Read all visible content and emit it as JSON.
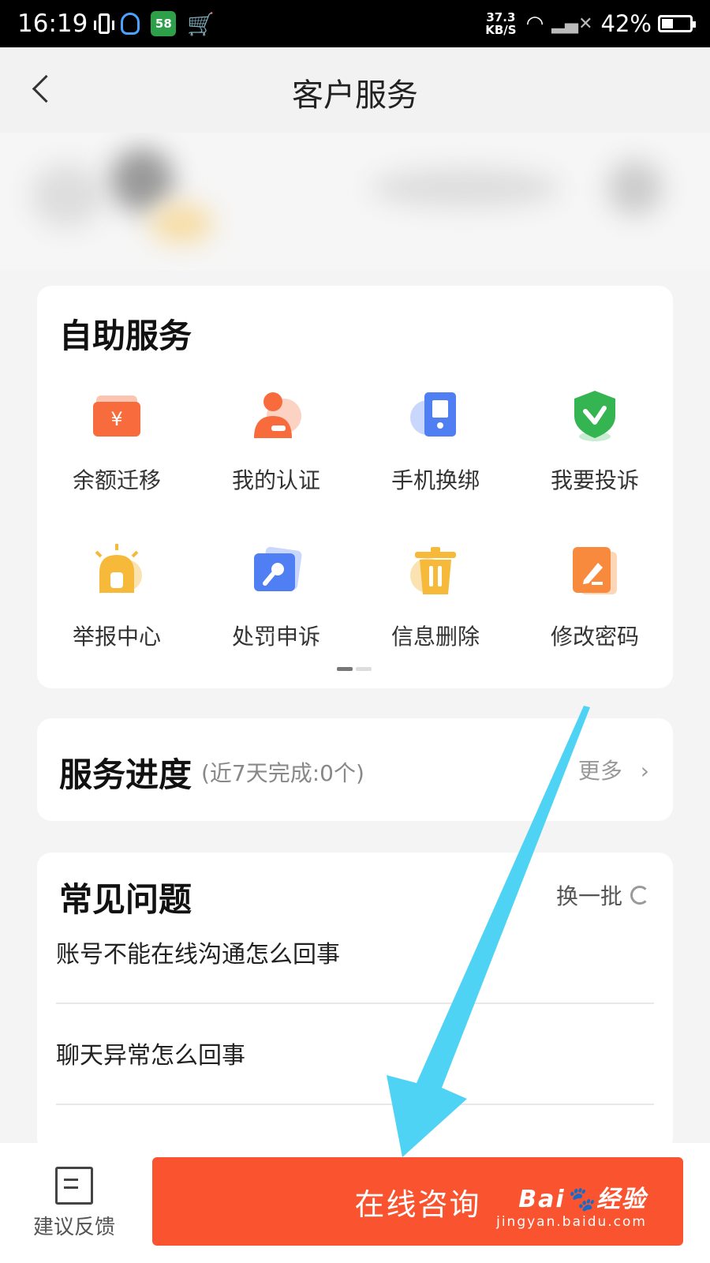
{
  "status_bar": {
    "time": "16:19",
    "app58": "58",
    "net_speed_value": "37.3",
    "net_speed_unit": "KB/S",
    "battery_pct": "42%",
    "battery_level": 0.42
  },
  "navbar": {
    "title": "客户服务"
  },
  "self_service": {
    "title": "自助服务",
    "items": [
      {
        "label": "余额迁移",
        "icon": "wallet-icon",
        "glyph": "¥",
        "color": "#f86b3d"
      },
      {
        "label": "我的认证",
        "icon": "user-verify-icon",
        "color": "#f86b3d"
      },
      {
        "label": "手机换绑",
        "icon": "phone-icon",
        "color": "#4f7ff2"
      },
      {
        "label": "我要投诉",
        "icon": "shield-check-icon",
        "color": "#34b552"
      },
      {
        "label": "举报中心",
        "icon": "alarm-icon",
        "color": "#f6b93a"
      },
      {
        "label": "处罚申诉",
        "icon": "appeal-icon",
        "color": "#4f7ff2"
      },
      {
        "label": "信息删除",
        "icon": "trash-icon",
        "color": "#f6b93a"
      },
      {
        "label": "修改密码",
        "icon": "edit-icon",
        "color": "#f88a3d"
      }
    ],
    "page_indicator": {
      "pages": 2,
      "active": 0
    }
  },
  "service_progress": {
    "title": "服务进度",
    "subtitle": "(近7天完成:0个)",
    "more": "更多"
  },
  "faq": {
    "title": "常见问题",
    "refresh": "换一批",
    "items": [
      "账号不能在线沟通怎么回事",
      "聊天异常怎么回事"
    ]
  },
  "bottom_bar": {
    "feedback": "建议反馈",
    "consult": "在线咨询"
  },
  "watermark": {
    "logo": "Bai🐾经验",
    "url": "jingyan.baidu.com"
  },
  "colors": {
    "accent": "#f9542f",
    "arrow": "#4fd3f5"
  }
}
